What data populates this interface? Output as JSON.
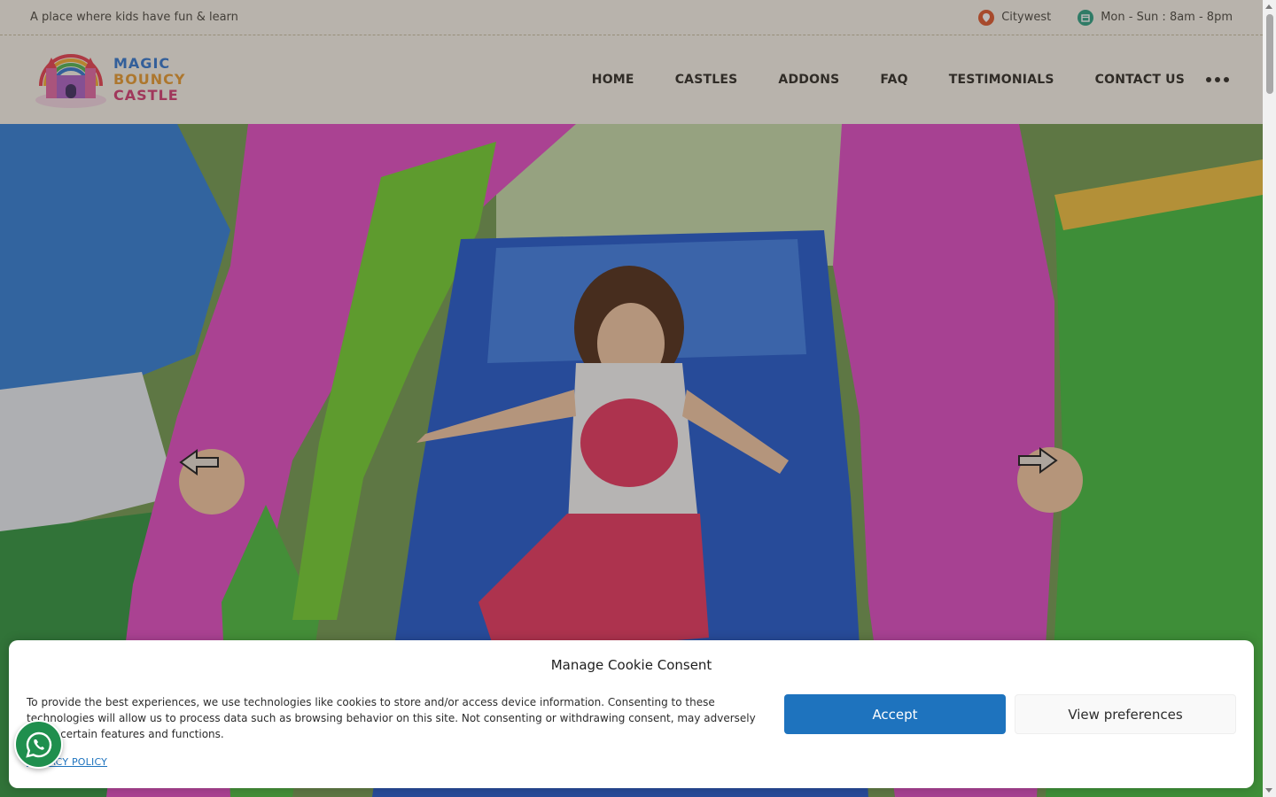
{
  "topbar": {
    "tagline": "A place where kids have fun & learn",
    "location": "Citywest",
    "hours": "Mon - Sun : 8am - 8pm"
  },
  "logo": {
    "line1": "MAGIC",
    "line2": "BOUNCY",
    "line3": "CASTLE"
  },
  "nav": {
    "items": [
      {
        "label": "HOME",
        "active": true
      },
      {
        "label": "CASTLES"
      },
      {
        "label": "ADDONS"
      },
      {
        "label": "FAQ"
      },
      {
        "label": "TESTIMONIALS"
      },
      {
        "label": "CONTACT US"
      }
    ]
  },
  "cookie": {
    "title": "Manage Cookie Consent",
    "text": "To provide the best experiences, we use technologies like cookies to store and/or access device information. Consenting to these technologies will allow us to process data such as browsing behavior on this site. Not consenting or withdrawing consent, may adversely affect certain features and functions.",
    "accept_label": "Accept",
    "preferences_label": "View preferences",
    "privacy_link": "PRIVACY POLICY"
  },
  "colors": {
    "accent_blue": "#1e73be",
    "whatsapp_green": "#1f8f4e",
    "header_bg": "#f7f3ea"
  }
}
